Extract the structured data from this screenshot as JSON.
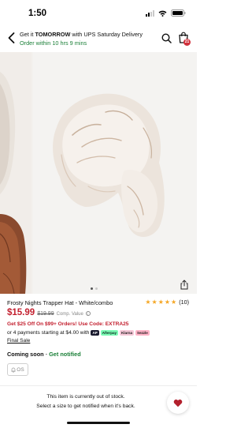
{
  "status_bar": {
    "time": "1:50"
  },
  "header": {
    "delivery_prefix": "Get it ",
    "delivery_day": "TOMORROW",
    "delivery_suffix": " with UPS Saturday Delivery",
    "order_within": "Order within 10 hrs 9 mins",
    "cart_count": "21"
  },
  "gallery": {
    "total_dots": 2,
    "active_dot": 1
  },
  "product": {
    "title": "Frosty Nights Trapper Hat - White/combo",
    "rating_stars": 5,
    "review_count": "(10)",
    "price": "$15.99",
    "compare_price": "$19.99",
    "compare_label": "Comp. Value",
    "info_glyph": "i",
    "promo": "Get $25 Off On $99+ Orders! Use Code: EXTRA25",
    "installments_text": "or 4 payments starting at $4.00 with",
    "pay_logos": [
      "AP",
      "Afterpay",
      "Klarna",
      "Sezzle"
    ],
    "final_sale": "Final Sale"
  },
  "availability": {
    "label": "Coming soon",
    "separator": " - ",
    "notify_link": "Get notified"
  },
  "size": {
    "option": "OS"
  },
  "out_of_stock": {
    "line1": "This item is currently out of stock.",
    "line2": "Select a size to get notified when it's back."
  },
  "colors": {
    "accent_red": "#c3202f",
    "green": "#1a7f37",
    "star": "#f5a623"
  }
}
